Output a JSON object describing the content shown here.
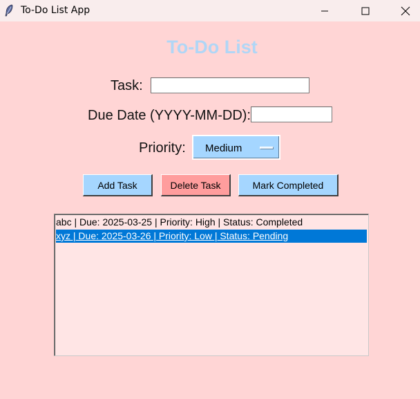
{
  "window": {
    "title": "To-Do List App",
    "controls": [
      "minimize-icon",
      "maximize-icon",
      "close-icon"
    ]
  },
  "heading": "To-Do List",
  "form": {
    "task_label": "Task:",
    "task_value": "",
    "due_label": "Due Date (YYYY-MM-DD):",
    "due_value": "",
    "priority_label": "Priority:",
    "priority_selected": "Medium"
  },
  "buttons": {
    "add": "Add Task",
    "delete": "Delete Task",
    "mark": "Mark Completed"
  },
  "tasks": [
    {
      "text": "abc | Due: 2025-03-25 | Priority: High | Status: Completed",
      "selected": false
    },
    {
      "text": "xyz | Due: 2025-03-26 | Priority: Low | Status: Pending",
      "selected": true
    }
  ],
  "colors": {
    "background": "#ffd5d5",
    "heading": "#b0d6f6",
    "accent_blue": "#a5d6ff",
    "delete_red": "#ff9d9d",
    "selection": "#0078d7",
    "listbox_bg": "#ffe5e5"
  }
}
